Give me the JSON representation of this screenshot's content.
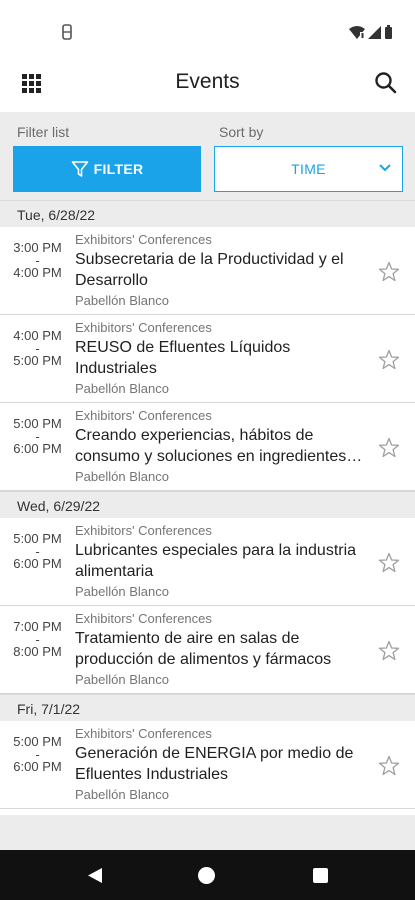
{
  "status_bar": {
    "left_icon": "notification-icon",
    "right_icons": [
      "wifi-icon",
      "signal-icon",
      "battery-icon"
    ]
  },
  "app_bar": {
    "title": "Events",
    "menu_icon": "grid-menu-icon",
    "search_icon": "search-icon"
  },
  "filters": {
    "filter_label": "Filter list",
    "sort_label": "Sort by",
    "filter_button": "FILTER",
    "sort_value": "TIME",
    "accent_color": "#1aa3e8"
  },
  "days": [
    {
      "date": "Tue, 6/28/22",
      "events": [
        {
          "start": "3:00 PM",
          "sep": "-",
          "end": "4:00 PM",
          "category": "Exhibitors' Conferences",
          "title": "Subsecretaria de la Productividad y el Desarrollo",
          "location": "Pabellón Blanco"
        },
        {
          "start": "4:00 PM",
          "sep": "-",
          "end": "5:00 PM",
          "category": "Exhibitors' Conferences",
          "title": "REUSO de Efluentes Líquidos Industriales",
          "location": "Pabellón Blanco"
        },
        {
          "start": "5:00 PM",
          "sep": "-",
          "end": "6:00 PM",
          "category": "Exhibitors' Conferences",
          "title": "Creando experiencias, hábitos de consumo y soluciones en ingredientes funcionales",
          "location": "Pabellón Blanco"
        }
      ]
    },
    {
      "date": "Wed, 6/29/22",
      "events": [
        {
          "start": "5:00 PM",
          "sep": "-",
          "end": "6:00 PM",
          "category": "Exhibitors' Conferences",
          "title": "Lubricantes especiales para la industria alimentaria",
          "location": "Pabellón Blanco"
        },
        {
          "start": "7:00 PM",
          "sep": "-",
          "end": "8:00 PM",
          "category": "Exhibitors' Conferences",
          "title": "Tratamiento de aire en salas de producción de alimentos y fármacos",
          "location": "Pabellón Blanco"
        }
      ]
    },
    {
      "date": "Fri, 7/1/22",
      "events": [
        {
          "start": "5:00 PM",
          "sep": "-",
          "end": "6:00 PM",
          "category": "Exhibitors' Conferences",
          "title": "Generación de ENERGIA por medio de Efluentes Industriales",
          "location": "Pabellón Blanco"
        }
      ]
    }
  ],
  "nav_bar": {
    "icons": [
      "back-icon",
      "home-icon",
      "recents-icon"
    ]
  }
}
